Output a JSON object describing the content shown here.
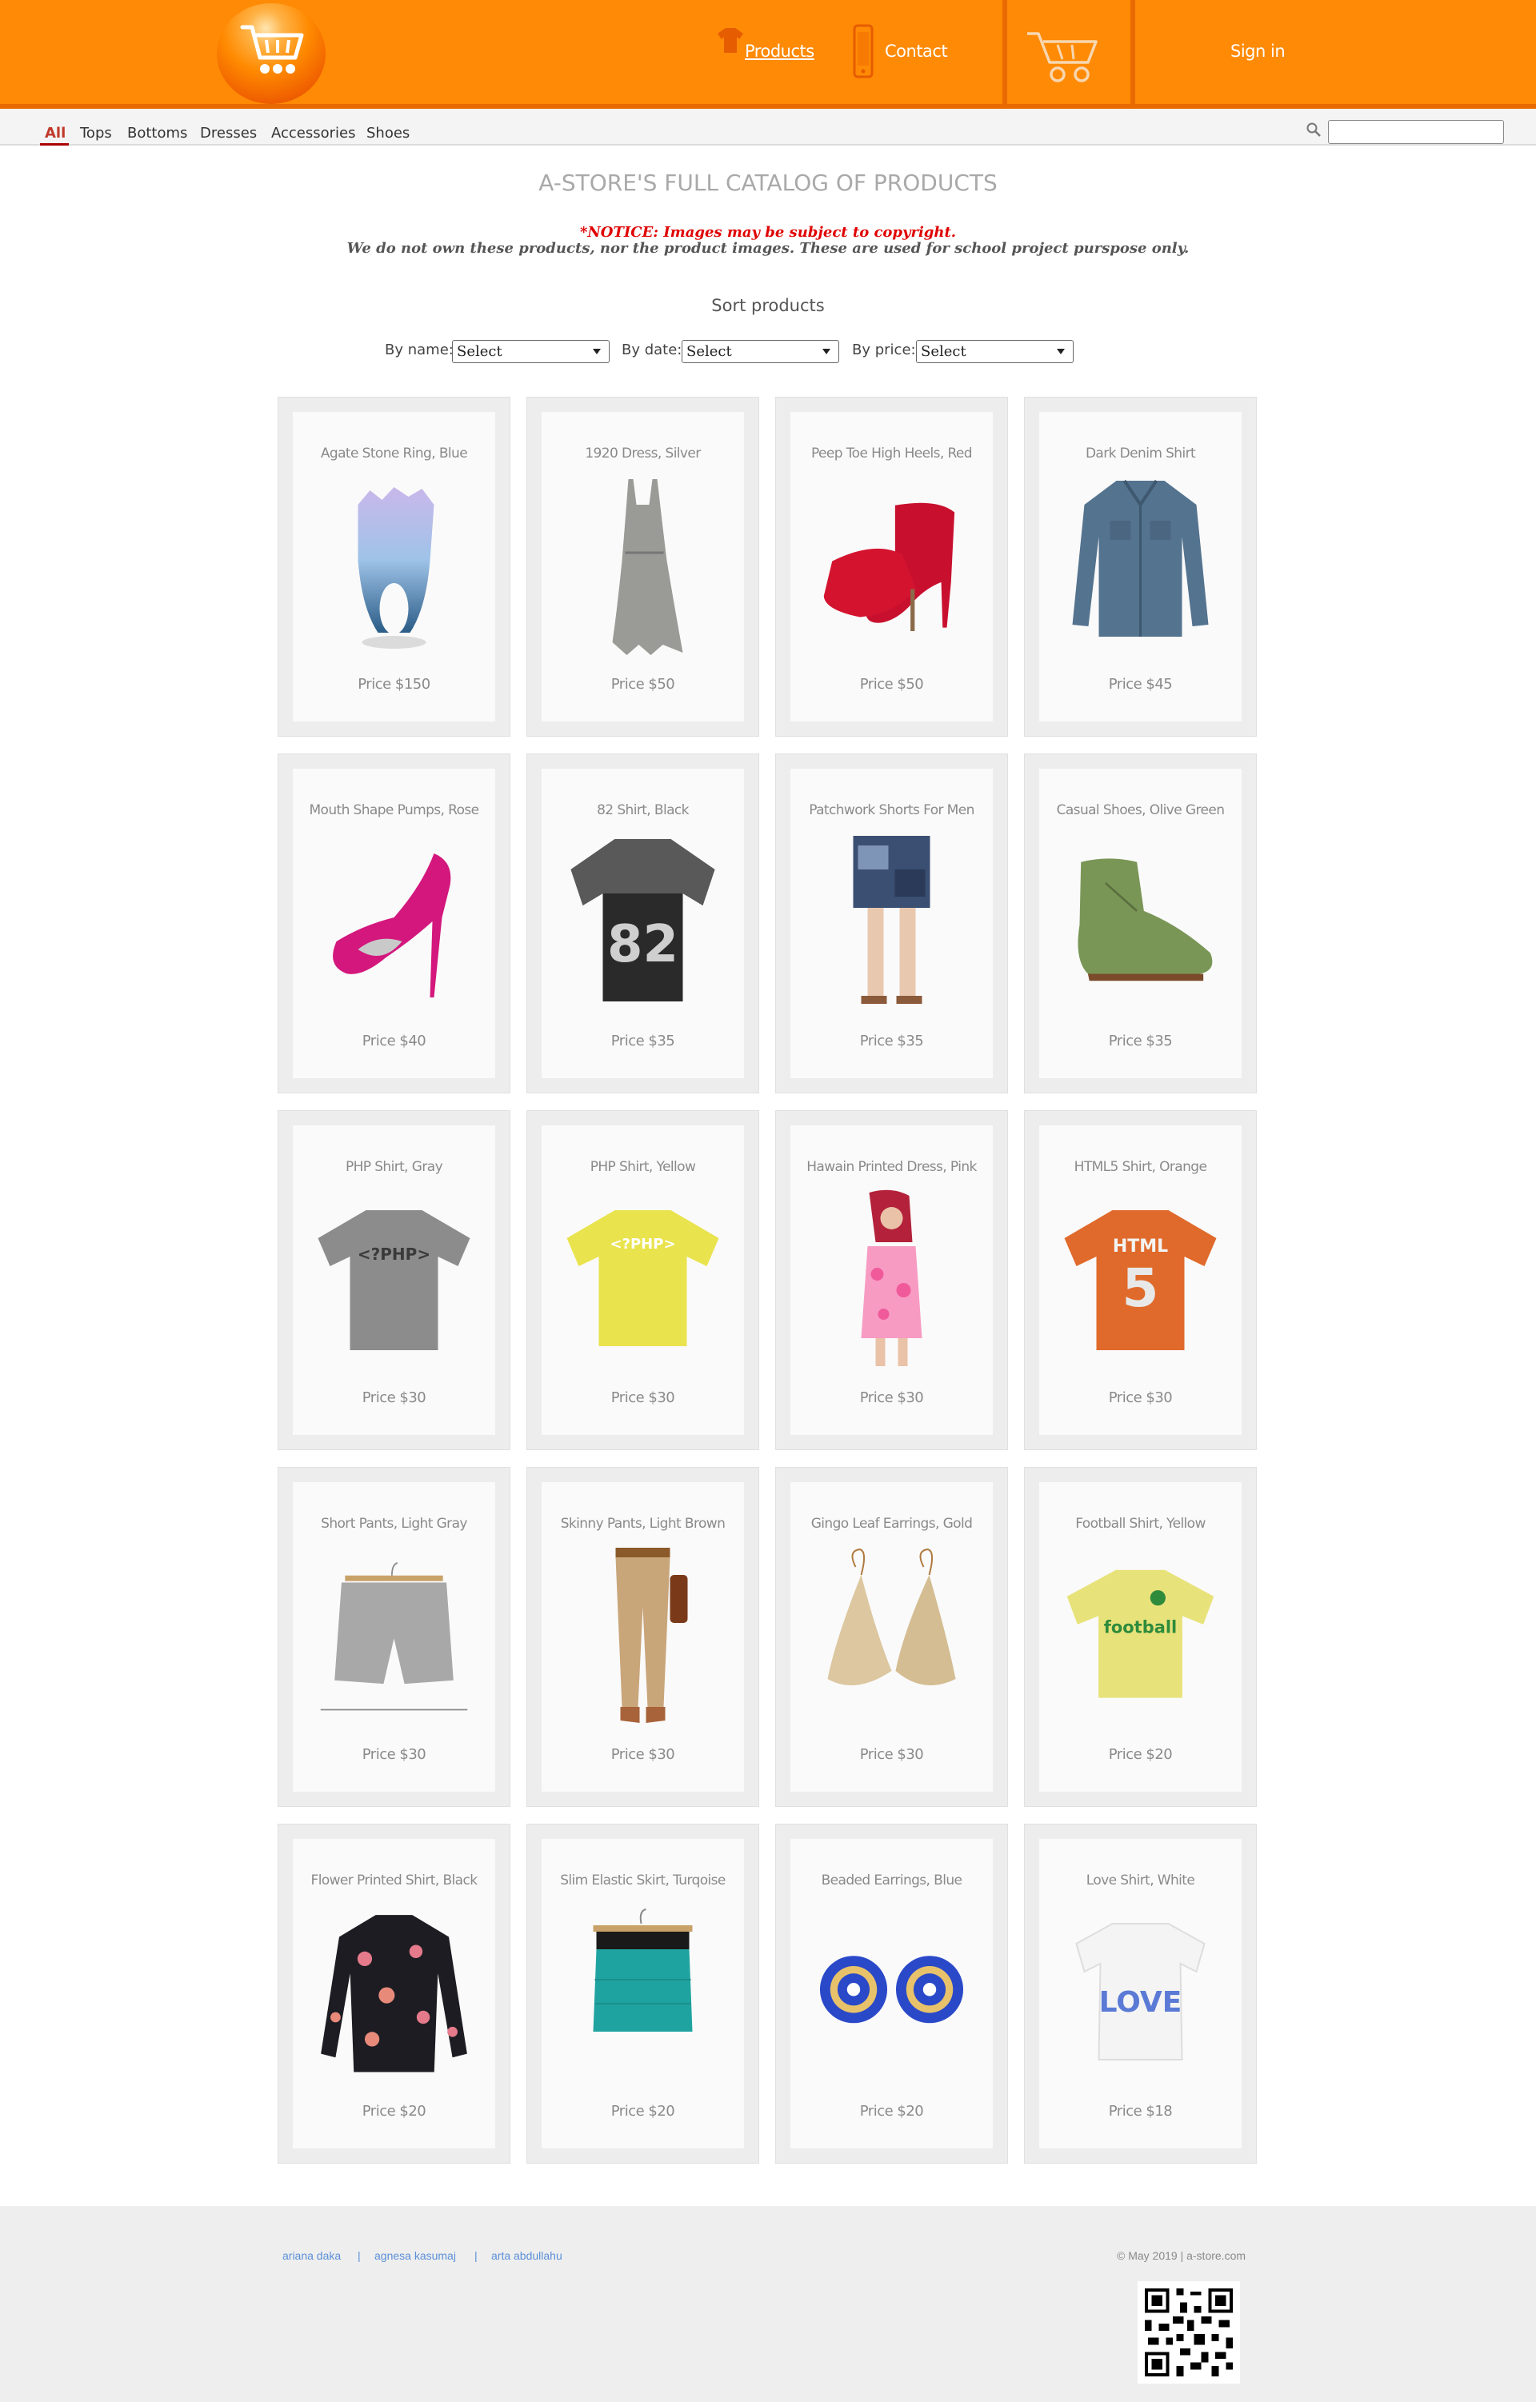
{
  "header": {
    "nav_products": "Products",
    "nav_contact": "Contact",
    "sign_in": "Sign in",
    "brand_color": "#ff8a05",
    "icons": [
      "shopping-cart-logo-icon",
      "tshirt-icon",
      "phone-icon",
      "shopping-cart-icon"
    ]
  },
  "categories": {
    "items": [
      "All",
      "Tops",
      "Bottoms",
      "Dresses",
      "Accessories",
      "Shoes"
    ],
    "active": "All"
  },
  "search": {
    "placeholder": "",
    "value": ""
  },
  "catalog": {
    "title": "A-STORE'S FULL CATALOG OF PRODUCTS",
    "notice": "*NOTICE: Images may be subject to copyright.",
    "disclaimer": "We do not own these products, nor the product images. These are used for school project purspose only."
  },
  "sort": {
    "title": "Sort products",
    "by_name_label": "By name:",
    "by_date_label": "By date:",
    "by_price_label": "By price:",
    "by_name_value": "Select",
    "by_date_value": "Select",
    "by_price_value": "Select"
  },
  "products": [
    {
      "name": "Agate Stone Ring, Blue",
      "price": "Price $150",
      "image": "ring"
    },
    {
      "name": "1920 Dress, Silver",
      "price": "Price $50",
      "image": "dress-silver"
    },
    {
      "name": "Peep Toe High Heels, Red",
      "price": "Price $50",
      "image": "heels-red"
    },
    {
      "name": "Dark Denim Shirt",
      "price": "Price $45",
      "image": "denim-shirt"
    },
    {
      "name": "Mouth Shape Pumps, Rose",
      "price": "Price $40",
      "image": "pumps-rose"
    },
    {
      "name": "82 Shirt, Black",
      "price": "Price $35",
      "image": "shirt-82"
    },
    {
      "name": "Patchwork Shorts For Men",
      "price": "Price $35",
      "image": "shorts-men"
    },
    {
      "name": "Casual Shoes, Olive Green",
      "price": "Price $35",
      "image": "shoe-olive"
    },
    {
      "name": "PHP Shirt, Gray",
      "price": "Price $30",
      "image": "php-gray"
    },
    {
      "name": "PHP Shirt, Yellow",
      "price": "Price $30",
      "image": "php-yellow"
    },
    {
      "name": "Hawain Printed Dress, Pink",
      "price": "Price $30",
      "image": "dress-pink"
    },
    {
      "name": "HTML5 Shirt, Orange",
      "price": "Price $30",
      "image": "html5-orange"
    },
    {
      "name": "Short Pants, Light Gray",
      "price": "Price $30",
      "image": "short-pants"
    },
    {
      "name": "Skinny Pants, Light Brown",
      "price": "Price $30",
      "image": "skinny-pants"
    },
    {
      "name": "Gingo Leaf Earrings, Gold",
      "price": "Price $30",
      "image": "earrings-gold"
    },
    {
      "name": "Football Shirt, Yellow",
      "price": "Price $20",
      "image": "football-shirt"
    },
    {
      "name": "Flower Printed Shirt, Black",
      "price": "Price $20",
      "image": "flower-shirt"
    },
    {
      "name": "Slim Elastic Skirt, Turqoise",
      "price": "Price $20",
      "image": "skirt-turq"
    },
    {
      "name": "Beaded Earrings, Blue",
      "price": "Price $20",
      "image": "earrings-blue"
    },
    {
      "name": "Love Shirt, White",
      "price": "Price $18",
      "image": "love-shirt"
    }
  ],
  "product_image_text": {
    "shirt_82": "82",
    "php_gray": "<?PHP>",
    "php_yellow": "<?PHP>",
    "html5_top": "HTML",
    "html5_num": "5",
    "football": "football",
    "love": "LOVE"
  },
  "footer": {
    "links": [
      "ariana daka",
      "agnesa kasumaj",
      "arta abdullahu"
    ],
    "separator": "|",
    "copyright": "© May 2019 | a-store.com"
  }
}
